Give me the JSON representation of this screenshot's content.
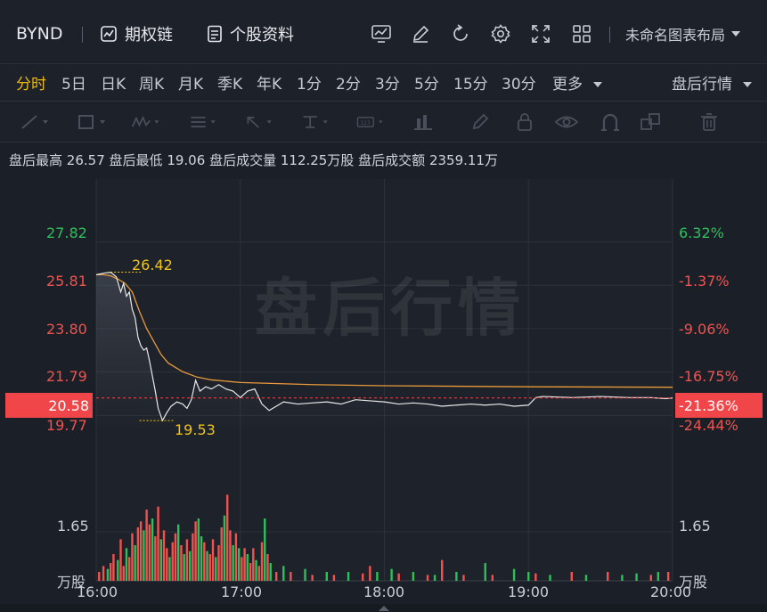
{
  "header": {
    "symbol": "BYND",
    "options_chain": "期权链",
    "stock_profile": "个股资料",
    "layout_name": "未命名图表布局"
  },
  "periods": {
    "tabs": [
      {
        "label": "分时",
        "active": true
      },
      {
        "label": "5日"
      },
      {
        "label": "日K"
      },
      {
        "label": "周K"
      },
      {
        "label": "月K"
      },
      {
        "label": "季K"
      },
      {
        "label": "年K"
      },
      {
        "label": "1分"
      },
      {
        "label": "2分"
      },
      {
        "label": "3分"
      },
      {
        "label": "5分"
      },
      {
        "label": "15分"
      },
      {
        "label": "30分"
      }
    ],
    "more": "更多",
    "session": "盘后行情"
  },
  "info": {
    "high_label": "盘后最高",
    "high": "26.57",
    "low_label": "盘后最低",
    "low": "19.06",
    "vol_label": "盘后成交量",
    "vol": "112.25万股",
    "amt_label": "盘后成交额",
    "amt": "2359.11万"
  },
  "watermark": "盘后行情",
  "colors": {
    "up": "#f0534f",
    "down": "#2fbf5a",
    "price": "#e8e8e8",
    "avg": "#e89a3c",
    "tag": "#f0464a"
  },
  "chart_data": {
    "type": "line",
    "x_ticks": [
      "16:00",
      "17:00",
      "18:00",
      "19:00",
      "20:00"
    ],
    "price_axis": [
      "27.82",
      "25.81",
      "23.80",
      "21.79",
      "19.77"
    ],
    "pct_axis": [
      "6.32%",
      "-1.37%",
      "-9.06%",
      "-16.75%",
      "-24.44%"
    ],
    "ylim": [
      19.0,
      28.3
    ],
    "current_price": "20.58",
    "current_pct": "-21.36%",
    "current_value": 20.58,
    "high_annotation": "26.42",
    "high_value": 26.42,
    "high_time": 0.1,
    "low_annotation": "19.53",
    "low_value": 19.53,
    "low_time": 0.3,
    "volume_axis_label": "1.65",
    "volume_unit": "万股",
    "volume_ylim": [
      0,
      3.0
    ],
    "price_series": [
      [
        0.0,
        26.3
      ],
      [
        0.06,
        26.38
      ],
      [
        0.1,
        26.42
      ],
      [
        0.14,
        26.2
      ],
      [
        0.17,
        25.5
      ],
      [
        0.19,
        25.9
      ],
      [
        0.21,
        25.3
      ],
      [
        0.23,
        25.5
      ],
      [
        0.25,
        24.7
      ],
      [
        0.27,
        24.3
      ],
      [
        0.29,
        23.4
      ],
      [
        0.31,
        23.0
      ],
      [
        0.33,
        22.8
      ],
      [
        0.35,
        22.9
      ],
      [
        0.37,
        22.3
      ],
      [
        0.39,
        21.6
      ],
      [
        0.41,
        20.9
      ],
      [
        0.43,
        20.1
      ],
      [
        0.46,
        19.53
      ],
      [
        0.49,
        19.9
      ],
      [
        0.52,
        20.2
      ],
      [
        0.56,
        20.4
      ],
      [
        0.6,
        20.3
      ],
      [
        0.63,
        20.1
      ],
      [
        0.66,
        20.5
      ],
      [
        0.69,
        21.4
      ],
      [
        0.72,
        20.9
      ],
      [
        0.76,
        21.1
      ],
      [
        0.8,
        21.0
      ],
      [
        0.85,
        21.2
      ],
      [
        0.9,
        21.0
      ],
      [
        0.95,
        20.9
      ],
      [
        1.0,
        20.6
      ],
      [
        1.05,
        20.9
      ],
      [
        1.1,
        21.0
      ],
      [
        1.15,
        20.3
      ],
      [
        1.2,
        20.0
      ],
      [
        1.25,
        20.2
      ],
      [
        1.3,
        20.4
      ],
      [
        1.4,
        20.3
      ],
      [
        1.5,
        20.35
      ],
      [
        1.6,
        20.4
      ],
      [
        1.7,
        20.3
      ],
      [
        1.8,
        20.5
      ],
      [
        1.9,
        20.45
      ],
      [
        2.0,
        20.4
      ],
      [
        2.1,
        20.3
      ],
      [
        2.2,
        20.35
      ],
      [
        2.3,
        20.3
      ],
      [
        2.4,
        20.2
      ],
      [
        2.5,
        20.25
      ],
      [
        2.6,
        20.3
      ],
      [
        2.7,
        20.25
      ],
      [
        2.8,
        20.3
      ],
      [
        2.9,
        20.2
      ],
      [
        3.0,
        20.25
      ],
      [
        3.05,
        20.6
      ],
      [
        3.1,
        20.65
      ],
      [
        3.3,
        20.6
      ],
      [
        3.5,
        20.65
      ],
      [
        3.7,
        20.6
      ],
      [
        3.85,
        20.6
      ],
      [
        3.95,
        20.55
      ],
      [
        4.0,
        20.58
      ]
    ],
    "avg_series": [
      [
        0.0,
        26.3
      ],
      [
        0.05,
        26.3
      ],
      [
        0.1,
        26.25
      ],
      [
        0.15,
        26.1
      ],
      [
        0.2,
        25.9
      ],
      [
        0.25,
        25.5
      ],
      [
        0.3,
        24.6
      ],
      [
        0.35,
        23.8
      ],
      [
        0.4,
        23.2
      ],
      [
        0.45,
        22.6
      ],
      [
        0.5,
        22.2
      ],
      [
        0.6,
        21.8
      ],
      [
        0.7,
        21.55
      ],
      [
        0.8,
        21.42
      ],
      [
        1.0,
        21.3
      ],
      [
        1.5,
        21.2
      ],
      [
        2.0,
        21.15
      ],
      [
        3.0,
        21.1
      ],
      [
        4.0,
        21.08
      ]
    ],
    "volume_bars": [
      [
        0.02,
        0.3,
        "up"
      ],
      [
        0.05,
        0.5,
        "up"
      ],
      [
        0.08,
        0.4,
        "down"
      ],
      [
        0.1,
        0.6,
        "up"
      ],
      [
        0.12,
        0.9,
        "up"
      ],
      [
        0.15,
        0.7,
        "down"
      ],
      [
        0.17,
        1.4,
        "up"
      ],
      [
        0.19,
        0.5,
        "up"
      ],
      [
        0.21,
        1.1,
        "down"
      ],
      [
        0.23,
        0.8,
        "up"
      ],
      [
        0.25,
        1.6,
        "up"
      ],
      [
        0.27,
        1.2,
        "down"
      ],
      [
        0.29,
        1.8,
        "up"
      ],
      [
        0.31,
        2.0,
        "up"
      ],
      [
        0.33,
        1.7,
        "down"
      ],
      [
        0.35,
        2.4,
        "up"
      ],
      [
        0.37,
        1.9,
        "up"
      ],
      [
        0.39,
        2.1,
        "down"
      ],
      [
        0.41,
        1.5,
        "up"
      ],
      [
        0.43,
        2.5,
        "up"
      ],
      [
        0.45,
        1.4,
        "down"
      ],
      [
        0.47,
        1.7,
        "up"
      ],
      [
        0.49,
        1.1,
        "up"
      ],
      [
        0.51,
        0.8,
        "down"
      ],
      [
        0.53,
        1.3,
        "up"
      ],
      [
        0.55,
        1.6,
        "up"
      ],
      [
        0.57,
        1.9,
        "down"
      ],
      [
        0.59,
        1.2,
        "up"
      ],
      [
        0.61,
        0.9,
        "down"
      ],
      [
        0.63,
        1.4,
        "up"
      ],
      [
        0.65,
        1.0,
        "down"
      ],
      [
        0.67,
        1.6,
        "up"
      ],
      [
        0.69,
        2.0,
        "up"
      ],
      [
        0.71,
        2.1,
        "down"
      ],
      [
        0.73,
        1.5,
        "down"
      ],
      [
        0.75,
        1.3,
        "up"
      ],
      [
        0.77,
        1.0,
        "down"
      ],
      [
        0.79,
        0.9,
        "up"
      ],
      [
        0.81,
        1.4,
        "up"
      ],
      [
        0.83,
        0.8,
        "down"
      ],
      [
        0.85,
        1.2,
        "up"
      ],
      [
        0.87,
        1.8,
        "up"
      ],
      [
        0.89,
        2.2,
        "down"
      ],
      [
        0.91,
        2.9,
        "up"
      ],
      [
        0.93,
        1.7,
        "up"
      ],
      [
        0.95,
        1.2,
        "down"
      ],
      [
        0.97,
        1.6,
        "up"
      ],
      [
        0.99,
        1.1,
        "down"
      ],
      [
        1.01,
        0.8,
        "up"
      ],
      [
        1.03,
        1.1,
        "up"
      ],
      [
        1.05,
        0.9,
        "down"
      ],
      [
        1.07,
        0.6,
        "up"
      ],
      [
        1.09,
        1.1,
        "up"
      ],
      [
        1.11,
        0.7,
        "down"
      ],
      [
        1.13,
        0.5,
        "up"
      ],
      [
        1.15,
        1.3,
        "up"
      ],
      [
        1.17,
        2.1,
        "down"
      ],
      [
        1.19,
        0.9,
        "up"
      ],
      [
        1.21,
        0.6,
        "down"
      ],
      [
        1.25,
        0.3,
        "up"
      ],
      [
        1.3,
        0.5,
        "down"
      ],
      [
        1.35,
        0.3,
        "up"
      ],
      [
        1.45,
        0.4,
        "down"
      ],
      [
        1.5,
        0.2,
        "up"
      ],
      [
        1.6,
        0.3,
        "down"
      ],
      [
        1.65,
        0.2,
        "up"
      ],
      [
        1.75,
        0.3,
        "down"
      ],
      [
        1.85,
        0.25,
        "up"
      ],
      [
        1.9,
        0.5,
        "up"
      ],
      [
        1.95,
        0.3,
        "down"
      ],
      [
        2.05,
        0.4,
        "down"
      ],
      [
        2.1,
        0.25,
        "up"
      ],
      [
        2.2,
        0.3,
        "down"
      ],
      [
        2.3,
        0.2,
        "up"
      ],
      [
        2.35,
        0.2,
        "down"
      ],
      [
        2.4,
        0.7,
        "up"
      ],
      [
        2.5,
        0.3,
        "down"
      ],
      [
        2.55,
        0.2,
        "up"
      ],
      [
        2.7,
        0.6,
        "down"
      ],
      [
        2.75,
        0.2,
        "up"
      ],
      [
        2.9,
        0.4,
        "down"
      ],
      [
        3.0,
        0.3,
        "down"
      ],
      [
        3.05,
        0.25,
        "up"
      ],
      [
        3.15,
        0.2,
        "down"
      ],
      [
        3.3,
        0.3,
        "up"
      ],
      [
        3.4,
        0.2,
        "down"
      ],
      [
        3.55,
        0.3,
        "up"
      ],
      [
        3.65,
        0.2,
        "down"
      ],
      [
        3.75,
        0.25,
        "down"
      ],
      [
        3.85,
        0.2,
        "up"
      ],
      [
        3.9,
        0.3,
        "down"
      ],
      [
        3.97,
        0.3,
        "up"
      ]
    ]
  }
}
